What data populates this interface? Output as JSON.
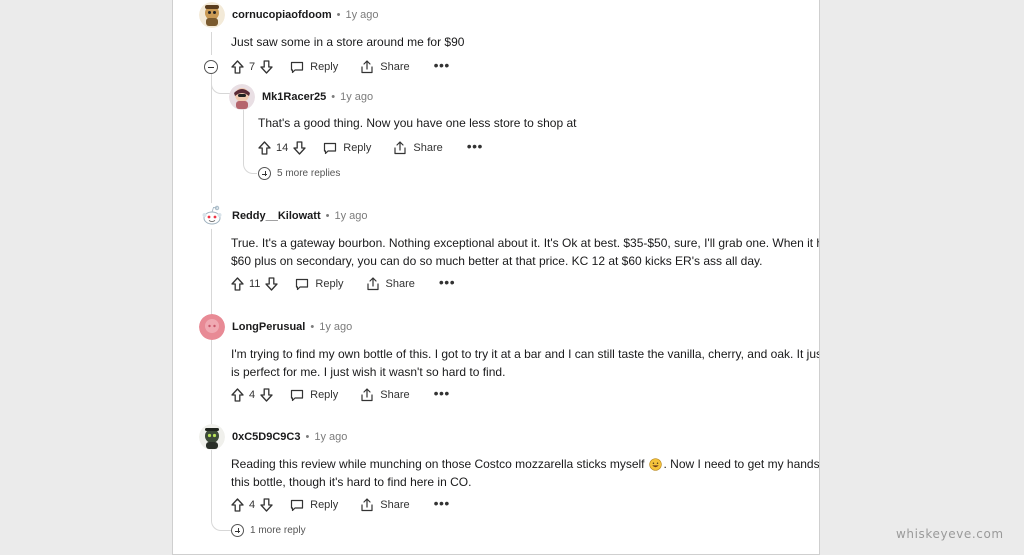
{
  "comments": [
    {
      "username": "cornucopiaofdoom",
      "age": "1y ago",
      "body": [
        "Just saw some in a store around me for $90"
      ],
      "votes": "7",
      "reply_label": "Reply",
      "share_label": "Share",
      "more_label": "•••",
      "avatar_icon": "snoo-avatar-icon",
      "avatar_color": "#c99a55"
    },
    {
      "username": "Mk1Racer25",
      "age": "1y ago",
      "body": [
        "That's a good thing. Now you have one less store to shop at"
      ],
      "votes": "14",
      "reply_label": "Reply",
      "share_label": "Share",
      "more_label": "•••",
      "more_replies": "5 more replies",
      "avatar_icon": "snoo-avatar-icon",
      "avatar_color": "#b5656d"
    },
    {
      "username": "Reddy__Kilowatt",
      "age": "1y ago",
      "body": [
        "True. It's a gateway bourbon. Nothing exceptional about it. It's Ok at best. $35-$50, sure, I'll grab one. When it hits",
        "$60 plus on secondary, you can do so much better at that price. KC 12 at $60 kicks ER's ass all day."
      ],
      "votes": "11",
      "reply_label": "Reply",
      "share_label": "Share",
      "more_label": "•••",
      "avatar_icon": "snoo-default-icon",
      "avatar_color": "#d9e3ea"
    },
    {
      "username": "LongPerusual",
      "age": "1y ago",
      "body": [
        "I'm trying to find my own bottle of this. I got to try it at a bar and I can still taste the vanilla, cherry, and oak. It just",
        "is perfect for me. I just wish it wasn't so hard to find."
      ],
      "votes": "4",
      "reply_label": "Reply",
      "share_label": "Share",
      "more_label": "•••",
      "avatar_icon": "pink-default-avatar-icon",
      "avatar_color": "#e88a95"
    },
    {
      "username": "0xC5D9C9C3",
      "age": "1y ago",
      "body": [
        "Reading this review while munching on those Costco mozzarella sticks myself",
        "this bottle, though it's hard to find here in CO."
      ],
      "body_after_emoji": ". Now I need to get my hands on",
      "emoji": "grinning-face-emoji",
      "votes": "4",
      "reply_label": "Reply",
      "share_label": "Share",
      "more_label": "•••",
      "more_replies": "1 more reply",
      "avatar_icon": "snoo-avatar-icon",
      "avatar_color": "#3d4a3a"
    }
  ],
  "watermark": "whiskeyeve.com"
}
